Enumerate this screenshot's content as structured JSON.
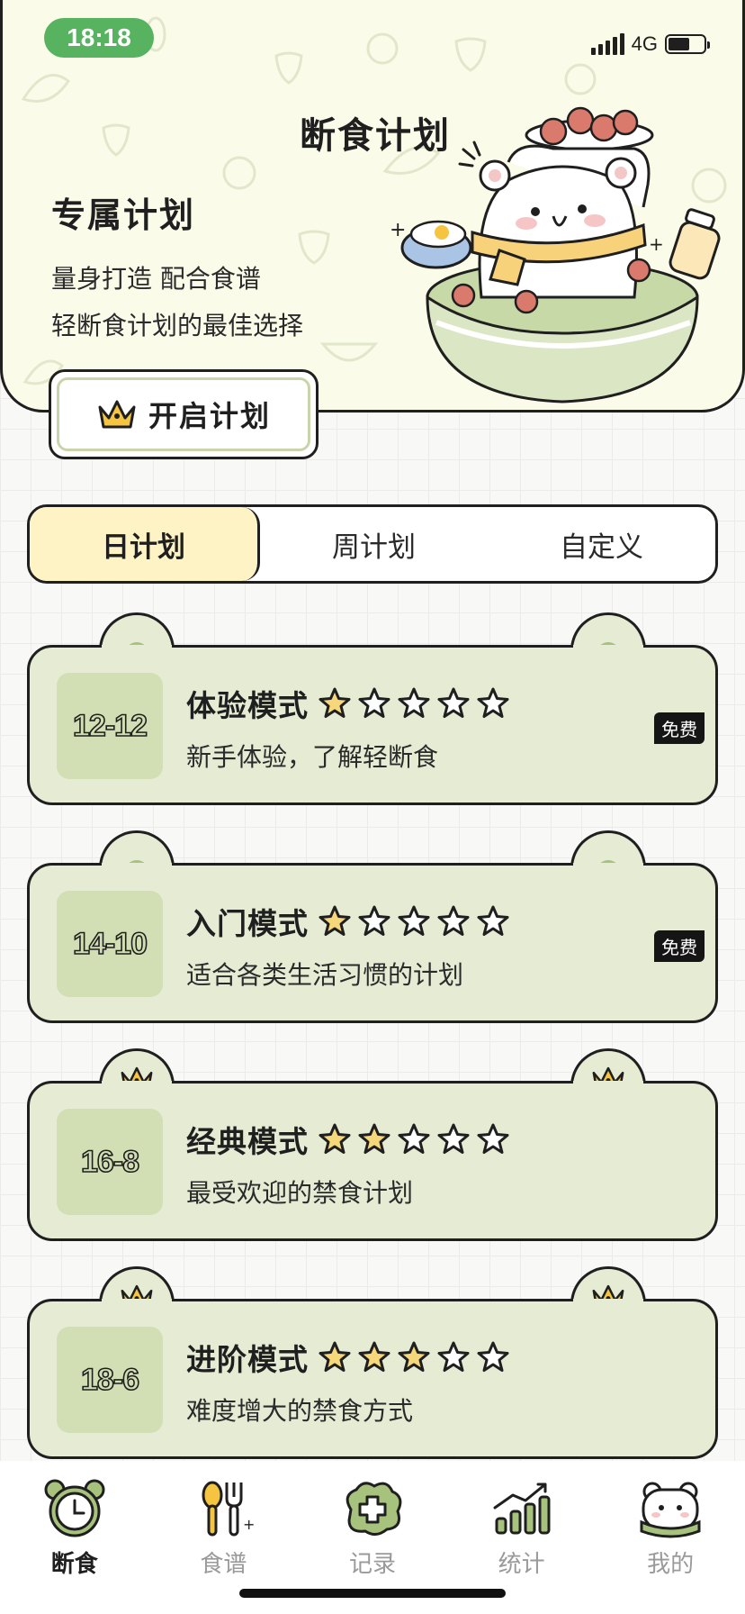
{
  "status_bar": {
    "time": "18:18",
    "network": "4G"
  },
  "header": {
    "title": "断食计划",
    "promo_heading": "专属计划",
    "promo_line1": "量身打造 配合食谱",
    "promo_line2": "轻断食计划的最佳选择",
    "start_button_label": "开启计划"
  },
  "tabs": [
    {
      "label": "日计划",
      "active": true
    },
    {
      "label": "周计划",
      "active": false
    },
    {
      "label": "自定义",
      "active": false
    }
  ],
  "plans": [
    {
      "ratio": "12-12",
      "title": "体验模式",
      "desc": "新手体验，了解轻断食",
      "difficulty": 1,
      "max_stars": 5,
      "badge": "免费",
      "ear_icon": "dot"
    },
    {
      "ratio": "14-10",
      "title": "入门模式",
      "desc": "适合各类生活习惯的计划",
      "difficulty": 1,
      "max_stars": 5,
      "badge": "免费",
      "ear_icon": "dot"
    },
    {
      "ratio": "16-8",
      "title": "经典模式",
      "desc": "最受欢迎的禁食计划",
      "difficulty": 2,
      "max_stars": 5,
      "badge": "",
      "ear_icon": "crown"
    },
    {
      "ratio": "18-6",
      "title": "进阶模式",
      "desc": "难度增大的禁食方式",
      "difficulty": 3,
      "max_stars": 5,
      "badge": "",
      "ear_icon": "crown"
    }
  ],
  "bottom_nav": [
    {
      "label": "断食",
      "icon": "alarm-clock-icon",
      "active": true
    },
    {
      "label": "食谱",
      "icon": "spoon-fork-icon",
      "active": false
    },
    {
      "label": "记录",
      "icon": "add-record-icon",
      "active": false
    },
    {
      "label": "统计",
      "icon": "stats-chart-icon",
      "active": false
    },
    {
      "label": "我的",
      "icon": "bear-profile-icon",
      "active": false
    }
  ],
  "colors": {
    "header_bg": "#fbfbe9",
    "card_bg": "#e6ebd4",
    "ratio_box_bg": "#d2deb3",
    "active_tab_bg": "#fdf3c4",
    "time_pill": "#57b35f",
    "star_fill": "#f6d77a"
  }
}
